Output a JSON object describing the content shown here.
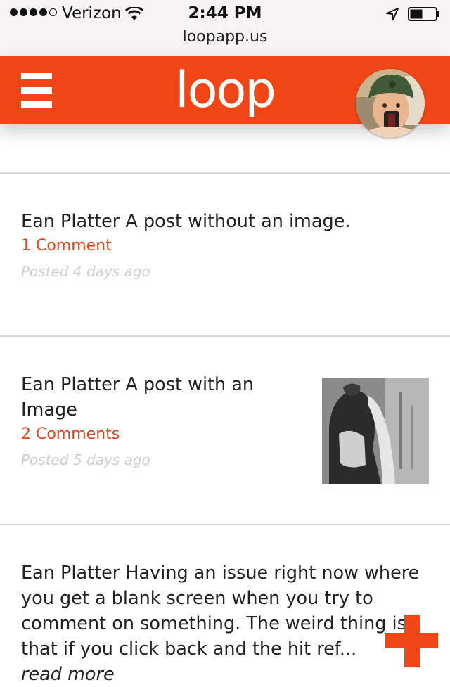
{
  "status_bar": {
    "carrier": "Verizon",
    "time": "2:44 PM",
    "url": "loopapp.us",
    "signal_bars": 4,
    "signal_total": 5,
    "battery_level": 0.45
  },
  "app_header": {
    "logo": "loop",
    "brand_color": "#f04615",
    "menu_icon": "hamburger-icon",
    "avatar_icon": "user-avatar"
  },
  "posts": [
    {
      "text": "Ean Platter A post without an image.",
      "comments": "1 Comment",
      "posted": "Posted 4 days ago"
    },
    {
      "text": "Ean Platter A post with an Image",
      "comments": "2 Comments",
      "posted": "Posted 5 days ago",
      "has_image": true
    },
    {
      "text": "Ean Platter Having an issue right now where you get a blank screen when you try to comment on something. The weird thing is that if you click back and the hit ref...",
      "more_link": "read more"
    }
  ],
  "fab": {
    "icon": "plus-icon",
    "color": "#f04615"
  }
}
